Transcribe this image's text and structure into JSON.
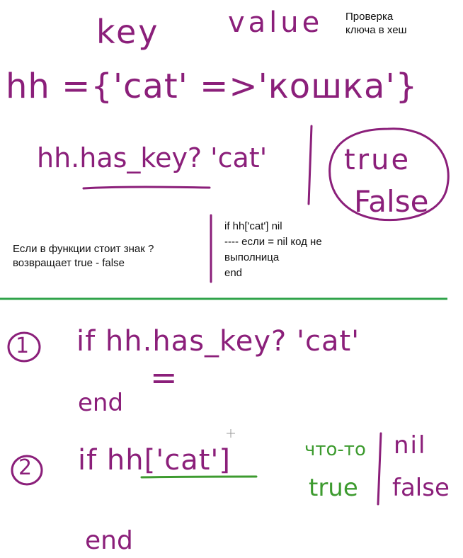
{
  "colors": {
    "ink_purple": "#8b1f7a",
    "ink_green": "#3d9b2f",
    "rule_green": "#2fa34a",
    "text": "#111111"
  },
  "top": {
    "key_label": "key",
    "value_label": "value",
    "hash_literal": "hh ={'cat' =>'кошка'}",
    "method_call": "hh.has_key? 'cat'",
    "true_word": "true",
    "false_word": "False"
  },
  "notes": {
    "check_key_line1": "Проверка",
    "check_key_line2": "ключа в хеш",
    "question_line1": "Если в функции стоит знак ?",
    "question_line2": "возвращает true - false",
    "nil_line1": "if hh['cat'] nil",
    "nil_line2": "----   если = nil код не",
    "nil_line3": "выполница",
    "nil_line4": "end"
  },
  "bottom": {
    "item1_number": "1",
    "item1_code": "if  hh.has_key? 'cat'",
    "item1_equals": "=",
    "item1_end": "end",
    "item2_number": "2",
    "item2_code": "if  hh['cat']",
    "item2_end": "end",
    "something": "что-то",
    "true_green": "true",
    "nil_word": "nil",
    "false_word": "false"
  }
}
